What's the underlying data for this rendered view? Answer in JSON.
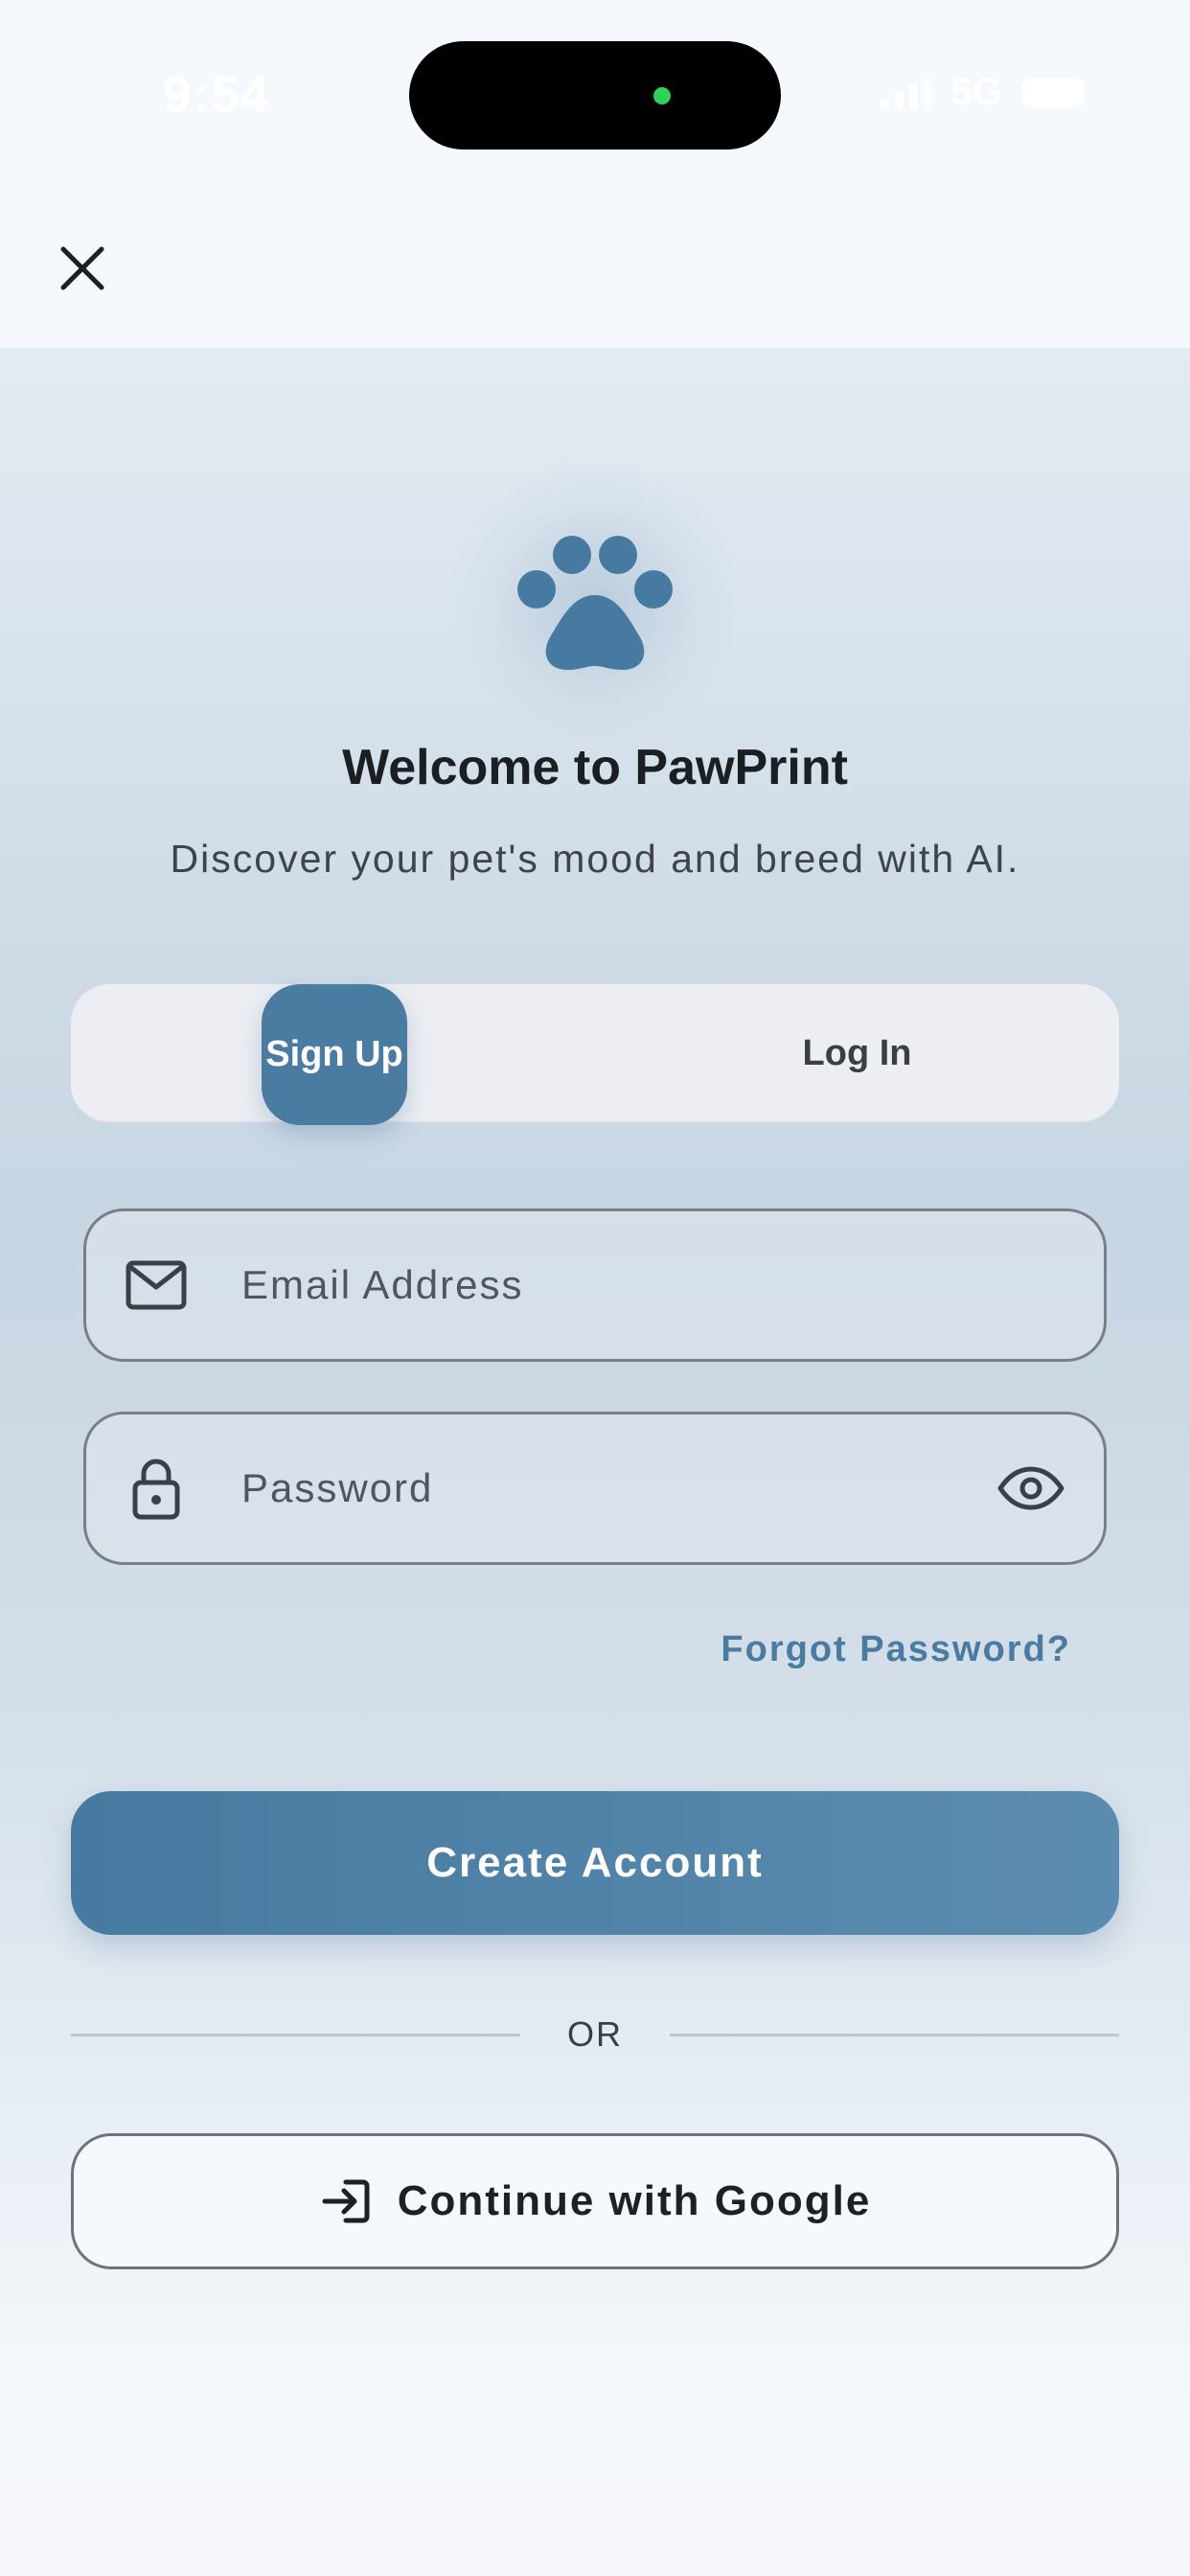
{
  "status_bar": {
    "time": "9:54",
    "network": "5G"
  },
  "nav": {
    "close_icon": "close-icon"
  },
  "header": {
    "logo_icon": "paw-icon",
    "title": "Welcome to PawPrint",
    "subtitle": "Discover your pet's mood and breed with AI."
  },
  "auth_toggle": {
    "signup_label": "Sign Up",
    "login_label": "Log In",
    "selected": "Sign Up"
  },
  "form": {
    "email": {
      "placeholder": "Email Address",
      "value": "",
      "icon": "mail-icon"
    },
    "password": {
      "placeholder": "Password",
      "value": "",
      "icon": "lock-icon",
      "toggle_icon": "eye-icon"
    },
    "forgot_label": "Forgot Password?",
    "submit_label": "Create Account",
    "divider_label": "OR",
    "google_label": "Continue with Google",
    "google_icon": "sign-in-icon"
  },
  "colors": {
    "accent": "#4a7ba1",
    "background": "#f5f8fc",
    "text": "#1b1f24"
  }
}
